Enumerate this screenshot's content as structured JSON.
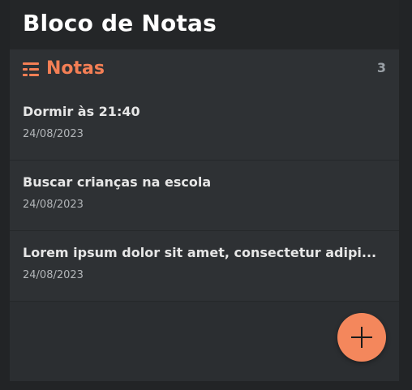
{
  "header": {
    "title": "Bloco de Notas"
  },
  "notes_section": {
    "icon": "list-icon",
    "title": "Notas",
    "count": "3",
    "accent_color": "#f47f55",
    "items": [
      {
        "title": "Dormir às 21:40",
        "date": "24/08/2023"
      },
      {
        "title": "Buscar crianças na escola",
        "date": "24/08/2023"
      },
      {
        "title": "Lorem ipsum dolor sit amet, consectetur adipi...",
        "date": "24/08/2023"
      }
    ]
  },
  "fab": {
    "icon": "plus-icon",
    "color": "#f4875c"
  }
}
